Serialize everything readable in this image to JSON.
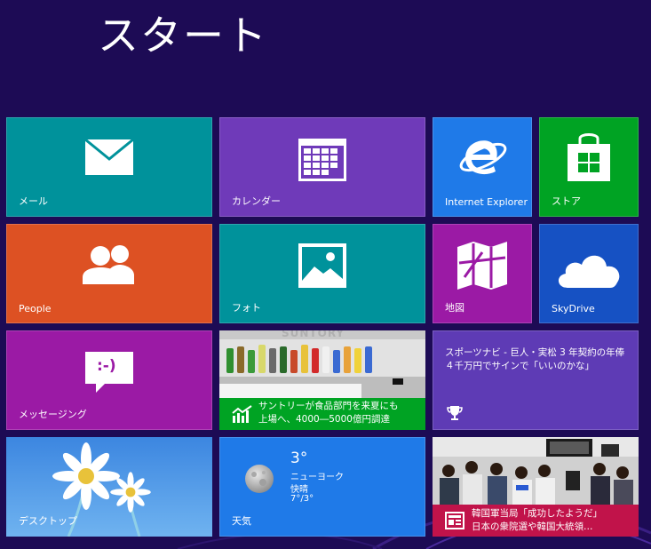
{
  "screen": {
    "title": "スタート",
    "background": "#1d0b55"
  },
  "tiles": {
    "mail": {
      "label": "メール",
      "icon": "mail-icon",
      "color": "#00929b"
    },
    "calendar": {
      "label": "カレンダー",
      "icon": "calendar-icon",
      "color": "#6f3ab9"
    },
    "ie": {
      "label": "Internet Explorer",
      "icon": "ie-icon",
      "color": "#1f7ae8"
    },
    "store": {
      "label": "ストア",
      "icon": "store-bag-icon",
      "color": "#00a323"
    },
    "people": {
      "label": "People",
      "icon": "people-icon",
      "color": "#dd5123"
    },
    "photos": {
      "label": "フォト",
      "icon": "photo-icon",
      "color": "#00929b"
    },
    "maps": {
      "label": "地図",
      "icon": "map-icon",
      "color": "#9b1aa5"
    },
    "skydrive": {
      "label": "SkyDrive",
      "icon": "cloud-icon",
      "color": "#1651c3"
    },
    "messaging": {
      "label": "メッセージング",
      "icon": "chat-bubble-icon",
      "color": "#9b1aa5",
      "emoticon": ":-)"
    },
    "finance": {
      "headline_line1": "サントリーが食品部門を来夏にも",
      "headline_line2": "上場へ、4000―5000億円調達",
      "icon": "finance-chart-icon",
      "color": "#00a323",
      "photo_text": "SUNTORY"
    },
    "sports": {
      "headline_line1": "スポーツナビ - 巨人・実松 3 年契約の年俸",
      "headline_line2": "４千万円でサインで「いいのかな」",
      "icon": "trophy-icon",
      "color": "#5e3bb5"
    },
    "desktop": {
      "label": "デスクトップ",
      "icon": "daisy-wallpaper",
      "color": "#2e73d6"
    },
    "weather": {
      "label": "天気",
      "icon": "moon-icon",
      "temperature": "3°",
      "city": "ニューヨーク",
      "condition": "快晴",
      "range": "7°/3°",
      "color": "#1f7ae8"
    },
    "news": {
      "headline_line1": "韓国軍当局「成功したようだ」",
      "headline_line2": "日本の衆院選や韓国大統領…",
      "icon": "news-icon",
      "color": "#c1134a"
    }
  }
}
